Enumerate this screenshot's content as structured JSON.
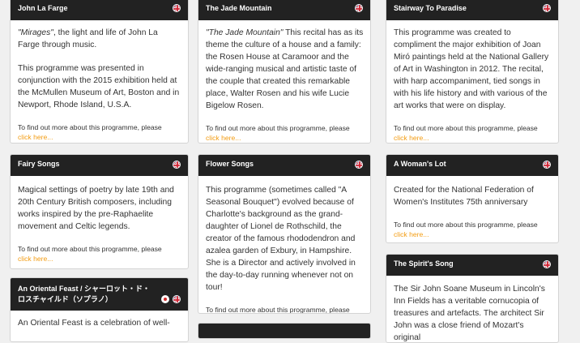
{
  "cards": {
    "c1": {
      "title": "John La Farge",
      "italic": "\"Mirages\"",
      "p1_rest": ", the light and life of John La Farge through music.",
      "p2": "This programme was presented in conjunction with the 2015 exhibition held at the McMullen Museum of Art, Boston and in Newport, Rhode Island, U.S.A."
    },
    "c2": {
      "title": "The Jade Mountain",
      "italic": "\"The Jade Mountain\"",
      "p1_rest": " This recital has as its theme the culture of a house and a family: the Rosen House at Caramoor and the wide-ranging musical and artistic taste of the couple that created this remarkable place, Walter Rosen and his wife Lucie Bigelow Rosen."
    },
    "c3": {
      "title": "Stairway To Paradise",
      "p1": "This programme was created to compliment the major exhibition of Joan Miró paintings held at the National Gallery of Art in Washington in 2012. The recital, with harp accompaniment, tied songs in with his life history and with various of the art works that were on display."
    },
    "c4": {
      "title": "Fairy Songs",
      "p1": "Magical settings of poetry by late 19th and 20th Century British composers, including works inspired by the pre-Raphaelite movement and Celtic legends."
    },
    "c5": {
      "title": "Flower Songs",
      "p1": "This programme (sometimes called \"A Seasonal Bouquet\") evolved because of Charlotte's background as the grand-daughter of Lionel de Rothschild, the creator of the famous rhododendron and azalea garden of Exbury, in Hampshire. She is a Director and actively involved in the day-to-day running whenever not on tour!"
    },
    "c6": {
      "title": "A Woman's Lot",
      "p1": "Created for the National Federation of Women's Institutes 75th anniversary"
    },
    "c7": {
      "title": "An Oriental Feast / シャーロット・ド・ロスチャイルド（ソプラノ）",
      "p1": "An Oriental Feast is a celebration of well-"
    },
    "c8": {
      "title": "The Spirit's Song",
      "p1": "The Sir John Soane Museum in Lincoln's Inn Fields has a veritable cornucopia of treasures and artefacts. The architect Sir John was a close friend of Mozart's original"
    }
  },
  "more_text": "To find out more about this programme, please",
  "more_link": "click here...",
  "colors": {
    "header_bg": "#222222",
    "link": "#f39c12",
    "page_bg": "#f0f0f0"
  },
  "icons": {
    "language_flag": "uk-flag-icon",
    "japanese_flag": "japan-flag-icon"
  }
}
